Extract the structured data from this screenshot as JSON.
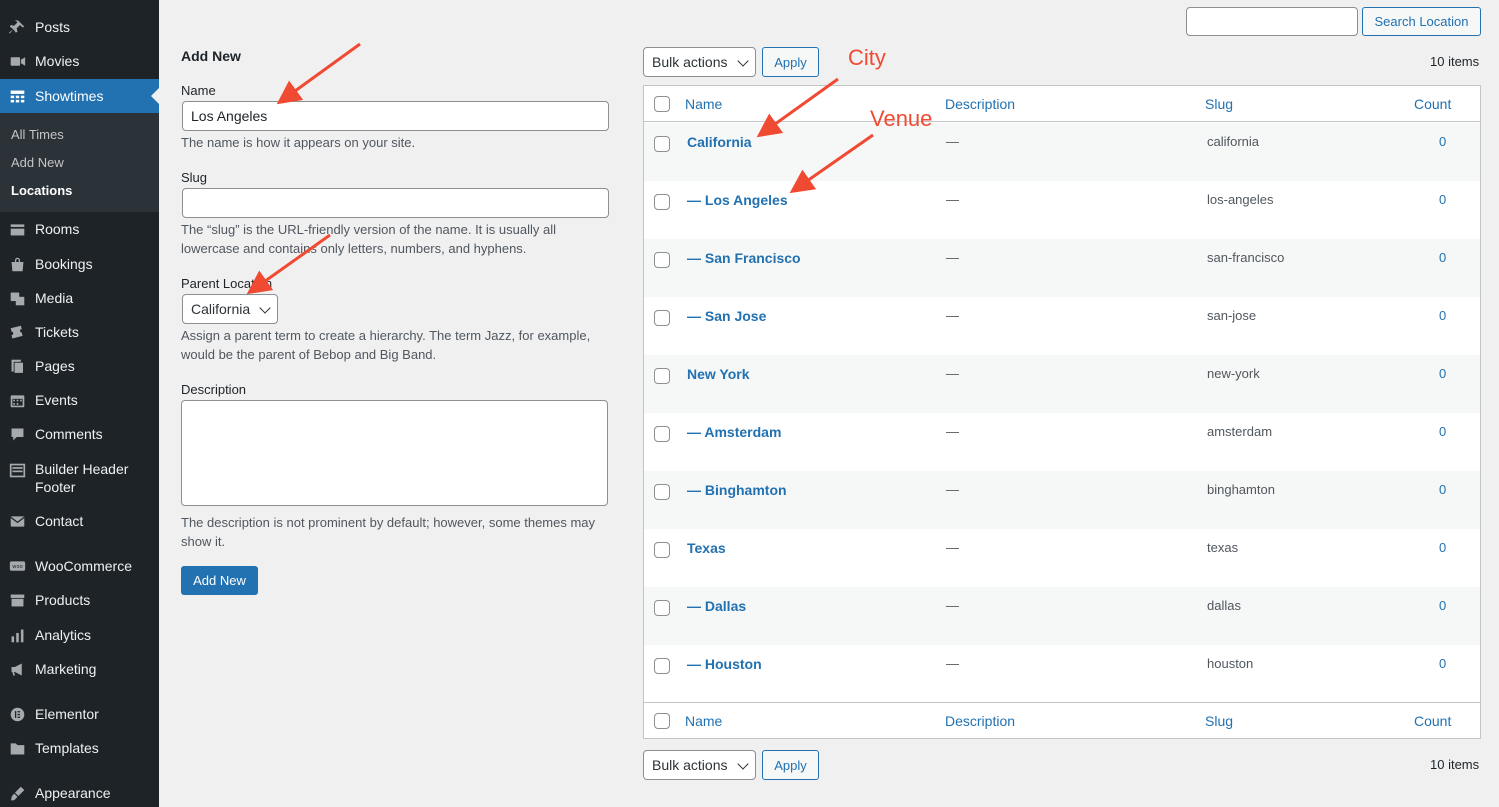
{
  "sidebar": {
    "items": [
      {
        "label": "Posts",
        "icon": "pin-icon"
      },
      {
        "label": "Movies",
        "icon": "video-icon"
      },
      {
        "label": "Showtimes",
        "icon": "grid-icon"
      },
      {
        "label": "Rooms",
        "icon": "rooms-icon"
      },
      {
        "label": "Bookings",
        "icon": "bag-icon"
      },
      {
        "label": "Media",
        "icon": "media-icon"
      },
      {
        "label": "Tickets",
        "icon": "tickets-icon"
      },
      {
        "label": "Pages",
        "icon": "pages-icon"
      },
      {
        "label": "Events",
        "icon": "calendar-icon"
      },
      {
        "label": "Comments",
        "icon": "comment-icon"
      },
      {
        "label": "Builder Header Footer",
        "icon": "builder-icon"
      },
      {
        "label": "Contact",
        "icon": "mail-icon"
      },
      {
        "label": "WooCommerce",
        "icon": "woo-icon"
      },
      {
        "label": "Products",
        "icon": "archive-icon"
      },
      {
        "label": "Analytics",
        "icon": "chart-icon"
      },
      {
        "label": "Marketing",
        "icon": "megaphone-icon"
      },
      {
        "label": "Elementor",
        "icon": "elementor-icon"
      },
      {
        "label": "Templates",
        "icon": "folder-icon"
      },
      {
        "label": "Appearance",
        "icon": "brush-icon"
      }
    ],
    "submenu": [
      "All Times",
      "Add New",
      "Locations"
    ]
  },
  "search": {
    "button_label": "Search Location",
    "value": ""
  },
  "form": {
    "title": "Add New",
    "name_label": "Name",
    "name_value": "Los Angeles",
    "name_help": "The name is how it appears on your site.",
    "slug_label": "Slug",
    "slug_value": "",
    "slug_help": "The “slug” is the URL-friendly version of the name. It is usually all lowercase and contains only letters, numbers, and hyphens.",
    "parent_label": "Parent Location",
    "parent_value": "California",
    "parent_help": "Assign a parent term to create a hierarchy. The term Jazz, for example, would be the parent of Bebop and Big Band.",
    "description_label": "Description",
    "description_help": "The description is not prominent by default; however, some themes may show it.",
    "submit_label": "Add New"
  },
  "bulk": {
    "select_value": "Bulk actions",
    "apply_label": "Apply",
    "items_count": "10 items"
  },
  "table": {
    "columns": [
      "Name",
      "Description",
      "Slug",
      "Count"
    ],
    "rows": [
      {
        "name": "California",
        "description": "—",
        "slug": "california",
        "count": "0"
      },
      {
        "name": "— Los Angeles",
        "description": "—",
        "slug": "los-angeles",
        "count": "0"
      },
      {
        "name": "— San Francisco",
        "description": "—",
        "slug": "san-francisco",
        "count": "0"
      },
      {
        "name": "— San Jose",
        "description": "—",
        "slug": "san-jose",
        "count": "0"
      },
      {
        "name": "New York",
        "description": "—",
        "slug": "new-york",
        "count": "0"
      },
      {
        "name": "— Amsterdam",
        "description": "—",
        "slug": "amsterdam",
        "count": "0"
      },
      {
        "name": "— Binghamton",
        "description": "—",
        "slug": "binghamton",
        "count": "0"
      },
      {
        "name": "Texas",
        "description": "—",
        "slug": "texas",
        "count": "0"
      },
      {
        "name": "— Dallas",
        "description": "—",
        "slug": "dallas",
        "count": "0"
      },
      {
        "name": "— Houston",
        "description": "—",
        "slug": "houston",
        "count": "0"
      }
    ]
  },
  "annotations": {
    "city": "City",
    "venue": "Venue",
    "color": "#f04a32"
  }
}
